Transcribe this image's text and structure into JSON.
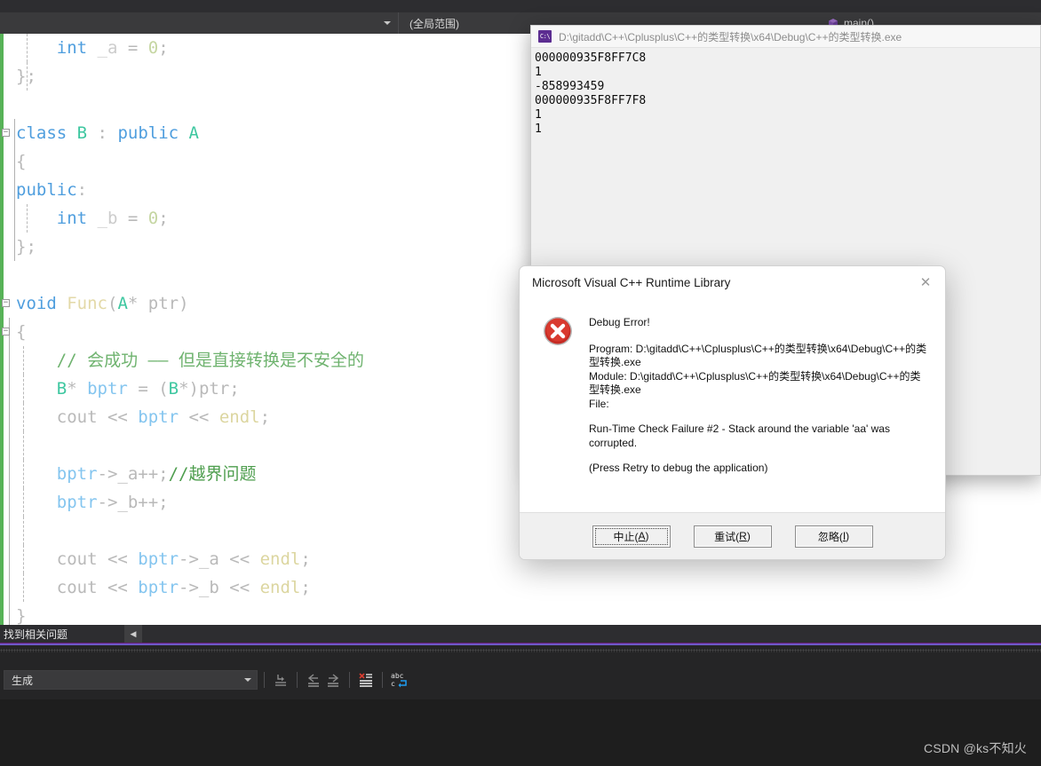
{
  "ide": {
    "scope_combo": "(全局范围)",
    "member_combo": "main()",
    "errorlist_status": "找到相关问题",
    "output_source": "生成",
    "toolbar_icons": [
      "go-to-source-icon",
      "navigate-back-icon",
      "navigate-forward-icon",
      "clear-output-icon",
      "word-wrap-icon"
    ]
  },
  "code": {
    "lines": [
      [
        {
          "t": "    ",
          "c": "idf"
        },
        {
          "t": "int",
          "c": "kw"
        },
        {
          "t": " ",
          "c": "idf"
        },
        {
          "t": "_a",
          "c": "pale"
        },
        {
          "t": " = ",
          "c": "op"
        },
        {
          "t": "0",
          "c": "num"
        },
        {
          "t": ";",
          "c": "op"
        }
      ],
      [
        {
          "t": "};",
          "c": "op"
        }
      ],
      [
        {
          "t": "",
          "c": "idf"
        }
      ],
      [
        {
          "t": "class",
          "c": "kw"
        },
        {
          "t": " ",
          "c": "idf"
        },
        {
          "t": "B",
          "c": "typ"
        },
        {
          "t": " : ",
          "c": "op"
        },
        {
          "t": "public",
          "c": "kw"
        },
        {
          "t": " ",
          "c": "idf"
        },
        {
          "t": "A",
          "c": "typ"
        }
      ],
      [
        {
          "t": "{",
          "c": "op"
        }
      ],
      [
        {
          "t": "public",
          "c": "kw"
        },
        {
          "t": ":",
          "c": "op"
        }
      ],
      [
        {
          "t": "    ",
          "c": "idf"
        },
        {
          "t": "int",
          "c": "kw"
        },
        {
          "t": " ",
          "c": "idf"
        },
        {
          "t": "_b",
          "c": "pale"
        },
        {
          "t": " = ",
          "c": "op"
        },
        {
          "t": "0",
          "c": "num"
        },
        {
          "t": ";",
          "c": "op"
        }
      ],
      [
        {
          "t": "};",
          "c": "op"
        }
      ],
      [
        {
          "t": "",
          "c": "idf"
        }
      ],
      [
        {
          "t": "void",
          "c": "kw"
        },
        {
          "t": " ",
          "c": "idf"
        },
        {
          "t": "Func",
          "c": "fn"
        },
        {
          "t": "(",
          "c": "op"
        },
        {
          "t": "A",
          "c": "typ"
        },
        {
          "t": "* ptr)",
          "c": "op"
        }
      ],
      [
        {
          "t": "{",
          "c": "op"
        }
      ],
      [
        {
          "t": "    ",
          "c": "idf"
        },
        {
          "t": "// 会成功 —— 但是直接转换是不安全的",
          "c": "cmt"
        }
      ],
      [
        {
          "t": "    ",
          "c": "idf"
        },
        {
          "t": "B",
          "c": "typ"
        },
        {
          "t": "* ",
          "c": "op"
        },
        {
          "t": "bptr",
          "c": "blue"
        },
        {
          "t": " = (",
          "c": "op"
        },
        {
          "t": "B",
          "c": "typ"
        },
        {
          "t": "*)ptr;",
          "c": "op"
        }
      ],
      [
        {
          "t": "    ",
          "c": "idf"
        },
        {
          "t": "cout << ",
          "c": "op"
        },
        {
          "t": "bptr",
          "c": "blue"
        },
        {
          "t": " << ",
          "c": "op"
        },
        {
          "t": "endl",
          "c": "endl"
        },
        {
          "t": ";",
          "c": "op"
        }
      ],
      [
        {
          "t": "",
          "c": "idf"
        }
      ],
      [
        {
          "t": "    ",
          "c": "idf"
        },
        {
          "t": "bptr",
          "c": "blue"
        },
        {
          "t": "->_a++;",
          "c": "op"
        },
        {
          "t": "//越界问题",
          "c": "cmt-strong"
        }
      ],
      [
        {
          "t": "    ",
          "c": "idf"
        },
        {
          "t": "bptr",
          "c": "blue"
        },
        {
          "t": "->_b++;",
          "c": "op"
        }
      ],
      [
        {
          "t": "",
          "c": "idf"
        }
      ],
      [
        {
          "t": "    ",
          "c": "idf"
        },
        {
          "t": "cout << ",
          "c": "op"
        },
        {
          "t": "bptr",
          "c": "blue"
        },
        {
          "t": "->_a",
          "c": "op"
        },
        {
          "t": " << ",
          "c": "op"
        },
        {
          "t": "endl",
          "c": "endl"
        },
        {
          "t": ";",
          "c": "op"
        }
      ],
      [
        {
          "t": "    ",
          "c": "idf"
        },
        {
          "t": "cout << ",
          "c": "op"
        },
        {
          "t": "bptr",
          "c": "blue"
        },
        {
          "t": "->_b",
          "c": "op"
        },
        {
          "t": " << ",
          "c": "op"
        },
        {
          "t": "endl",
          "c": "endl"
        },
        {
          "t": ";",
          "c": "op"
        }
      ],
      [
        {
          "t": "}",
          "c": "op"
        }
      ]
    ]
  },
  "console": {
    "icon": "console-app-icon",
    "title": "D:\\gitadd\\C++\\Cplusplus\\C++的类型转换\\x64\\Debug\\C++的类型转换.exe",
    "output": "000000935F8FF7C8\n1\n-858993459\n000000935F8FF7F8\n1\n1"
  },
  "dialog": {
    "title": "Microsoft Visual C++ Runtime Library",
    "close_label": "✕",
    "icon": "error-circle-x-icon",
    "heading": "Debug Error!",
    "program_line": "Program: D:\\gitadd\\C++\\Cplusplus\\C++的类型转换\\x64\\Debug\\C++的类型转换.exe",
    "module_line": "Module: D:\\gitadd\\C++\\Cplusplus\\C++的类型转换\\x64\\Debug\\C++的类型转换.exe",
    "file_line": "File:",
    "failure_line": "Run-Time Check Failure #2 - Stack around the variable 'aa' was corrupted.",
    "hint_line": "(Press Retry to debug the application)",
    "buttons": [
      {
        "label": "中止(",
        "accel": "A",
        "tail": ")",
        "name": "abort-button",
        "default": true
      },
      {
        "label": "重试(",
        "accel": "R",
        "tail": ")",
        "name": "retry-button",
        "default": false
      },
      {
        "label": "忽略(",
        "accel": "I",
        "tail": ")",
        "name": "ignore-button",
        "default": false
      }
    ]
  },
  "watermark": "CSDN @ks不知火",
  "colors": {
    "change_bar": "#57b257",
    "error_red": "#cf2a27",
    "accent_purple": "#68217a",
    "console_icon": "#5c2d91"
  }
}
